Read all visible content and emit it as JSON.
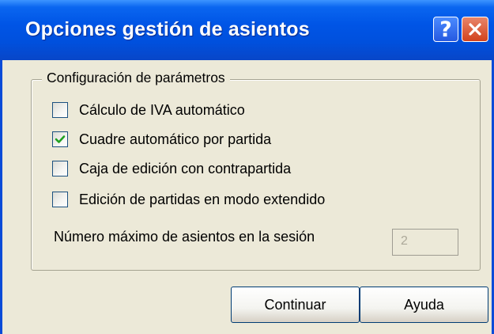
{
  "window": {
    "title": "Opciones gestión de asientos",
    "help_glyph": "?"
  },
  "group": {
    "legend": "Configuración de parámetros"
  },
  "options": [
    {
      "label": "Cálculo de IVA automático",
      "checked": false
    },
    {
      "label": "Cuadre automático por partida",
      "checked": true
    },
    {
      "label": "Caja de edición con contrapartida",
      "checked": false
    },
    {
      "label": "Edición de partidas en modo extendido",
      "checked": false
    }
  ],
  "max_sessions": {
    "label": "Número máximo de asientos en la sesión",
    "value": "2"
  },
  "buttons": {
    "continue": "Continuar",
    "help": "Ayuda"
  }
}
